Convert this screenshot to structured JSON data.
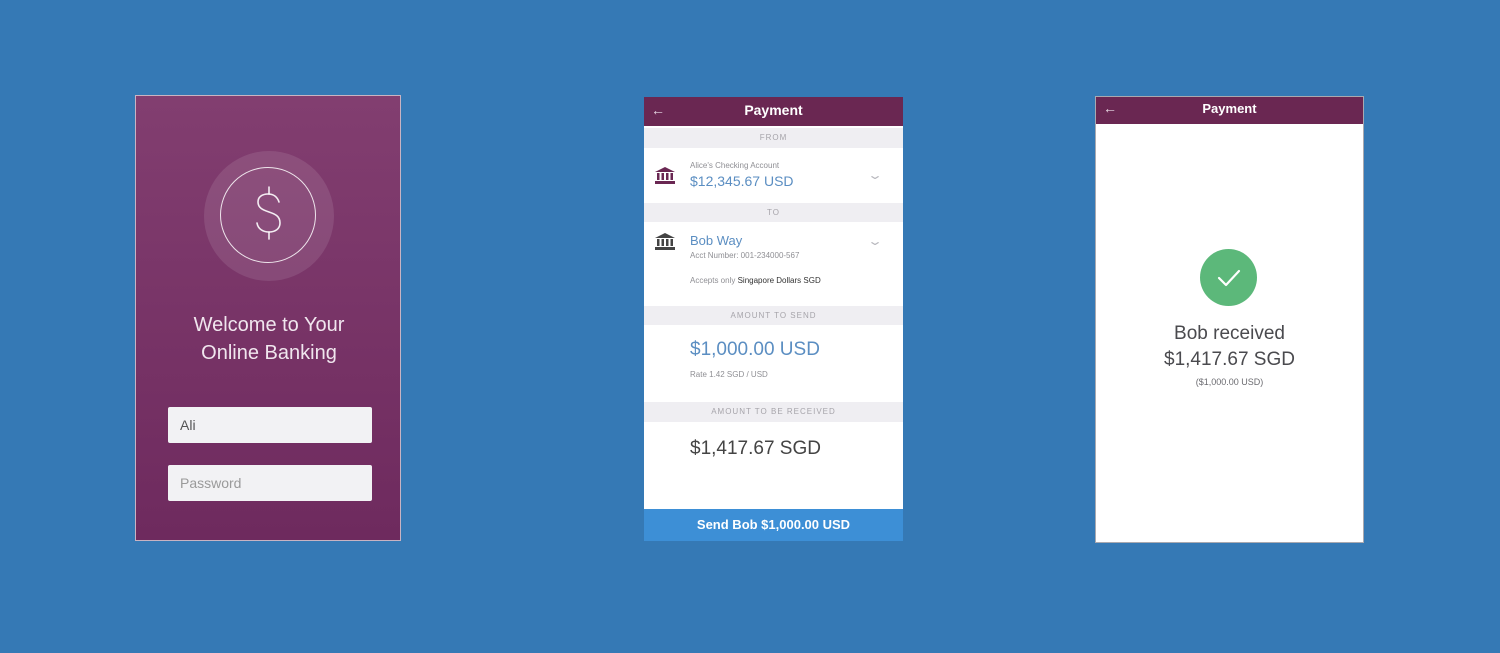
{
  "login": {
    "welcome_line1": "Welcome to Your",
    "welcome_line2": "Online Banking",
    "username_value": "Ali",
    "password_placeholder": "Password",
    "logo_icon": "dollar-coin-icon"
  },
  "payment": {
    "title": "Payment",
    "back_icon": "←",
    "from_header": "FROM",
    "from_account_name": "Alice's Checking Account",
    "from_balance": "$12,345.67 USD",
    "to_header": "TO",
    "to_name": "Bob Way",
    "to_acct": "Acct Number: 001-234000-567",
    "to_accepts_prefix": "Accepts only ",
    "to_accepts_currency": "Singapore Dollars SGD",
    "amount_send_header": "AMOUNT TO SEND",
    "amount_send": "$1,000.00 USD",
    "rate": "Rate 1.42 SGD / USD",
    "amount_received_header": "AMOUNT TO BE RECEIVED",
    "amount_received": "$1,417.67 SGD",
    "send_button": "Send Bob $1,000.00 USD"
  },
  "confirm": {
    "title": "Payment",
    "back_icon": "←",
    "line1": "Bob received",
    "line2": "$1,417.67 SGD",
    "line3": "($1,000.00 USD)"
  },
  "colors": {
    "background": "#3579b5",
    "brand_purple": "#6a2752",
    "accent_blue": "#3d8fd6",
    "success_green": "#5cb87a"
  }
}
